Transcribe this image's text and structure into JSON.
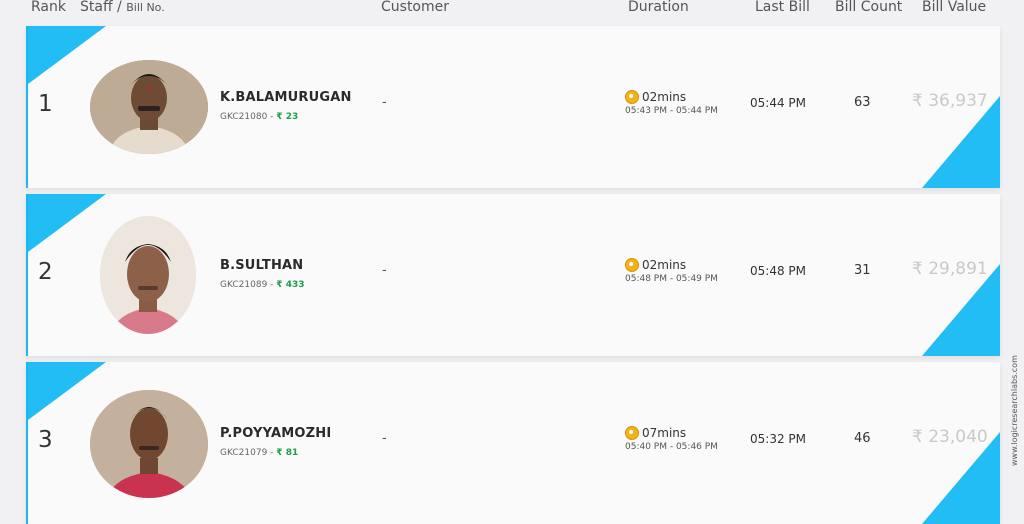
{
  "header": {
    "rank": "Rank",
    "staff": "Staff /",
    "bill_no": "Bill No.",
    "customer": "Customer",
    "duration": "Duration",
    "last_bill": "Last Bill",
    "bill_count": "Bill Count",
    "bill_value": "Bill Value"
  },
  "rows": [
    {
      "rank": "1",
      "name": "K.BALAMURUGAN",
      "bill_no": "GKC21080",
      "sep": " - ",
      "amount": "₹ 23",
      "customer": "-",
      "duration": "02mins",
      "range": "05:43 PM - 05:44 PM",
      "last_bill": "05:44 PM",
      "bill_count": "63",
      "bill_value": "₹ 36,937"
    },
    {
      "rank": "2",
      "name": "B.SULTHAN",
      "bill_no": "GKC21089",
      "sep": " - ",
      "amount": "₹ 433",
      "customer": "-",
      "duration": "02mins",
      "range": "05:48 PM - 05:49 PM",
      "last_bill": "05:48 PM",
      "bill_count": "31",
      "bill_value": "₹ 29,891"
    },
    {
      "rank": "3",
      "name": "P.POYYAMOZHI",
      "bill_no": "GKC21079",
      "sep": " - ",
      "amount": "₹ 81",
      "customer": "-",
      "duration": "07mins",
      "range": "05:40 PM - 05:46 PM",
      "last_bill": "05:32 PM",
      "bill_count": "46",
      "bill_value": "₹ 23,040"
    }
  ],
  "watermark": "www.logicresearchlabs.com",
  "colors": {
    "accent": "#21bdf4",
    "amount": "#1e9d4a",
    "clock": "#f2b21c"
  }
}
